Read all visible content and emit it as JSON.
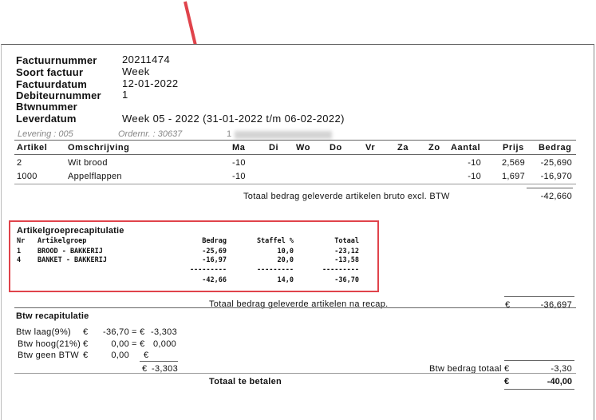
{
  "header": {
    "fields": [
      {
        "label": "Factuurnummer",
        "value": "20211474"
      },
      {
        "label": "Soort factuur",
        "value": "Week"
      },
      {
        "label": "Factuurdatum",
        "value": "12-01-2022"
      },
      {
        "label": "Debiteurnummer",
        "value": "1"
      },
      {
        "label": "Btwnummer",
        "value": ""
      },
      {
        "label": "Leverdatum",
        "value": "Week 05 - 2022 (31-01-2022 t/m 06-02-2022)"
      }
    ]
  },
  "delivery": {
    "levering": "Levering : 005",
    "ordernr": "Ordernr. : 30637",
    "code": "1"
  },
  "items_table": {
    "columns": [
      "Artikel",
      "Omschrijving",
      "Ma",
      "Di",
      "Wo",
      "Do",
      "Vr",
      "Za",
      "Zo",
      "Aantal",
      "Prijs",
      "Bedrag"
    ],
    "rows": [
      {
        "artikel": "2",
        "omschrijving": "Wit brood",
        "ma": "-10",
        "aantal": "-10",
        "prijs": "2,569",
        "bedrag": "-25,690"
      },
      {
        "artikel": "1000",
        "omschrijving": "Appelflappen",
        "ma": "-10",
        "aantal": "-10",
        "prijs": "1,697",
        "bedrag": "-16,970"
      }
    ],
    "total_label": "Totaal bedrag geleverde artikelen bruto excl. BTW",
    "total_value": "-42,660"
  },
  "recap": {
    "title": "Artikelgroeprecapitulatie",
    "columns": {
      "nr": "Nr",
      "group": "Artikelgroep",
      "bedrag": "Bedrag",
      "staffel": "Staffel %",
      "totaal": "Totaal"
    },
    "rows": [
      {
        "nr": "1",
        "group": "BROOD - BAKKERIJ",
        "bedrag": "-25,69",
        "staffel": "10,0",
        "totaal": "-23,12"
      },
      {
        "nr": "4",
        "group": "BANKET - BAKKERIJ",
        "bedrag": "-16,97",
        "staffel": "20,0",
        "totaal": "-13,58"
      }
    ],
    "dashes": "---------",
    "sum": {
      "bedrag": "-42,66",
      "staffel": "14,0",
      "totaal": "-36,70"
    }
  },
  "after_recap": {
    "label": "Totaal bedrag geleverde artikelen na recap.",
    "currency": "€",
    "value": "-36,697"
  },
  "btw": {
    "title": "Btw recapitulatie",
    "lines": [
      {
        "label": "Btw laag(9%)",
        "currency": "€",
        "base": "-36,70",
        "eq": "= €",
        "amount": "-3,303"
      },
      {
        "label": "Btw hoog(21%)",
        "currency": "€",
        "base": "0,00",
        "eq": "= €",
        "amount": "0,000"
      },
      {
        "label": "Btw geen BTW",
        "currency": "€",
        "base": "0,00",
        "eq": "€",
        "amount": ""
      }
    ],
    "subtotal_currency": "€",
    "subtotal": "-3,303",
    "total_label": "Btw bedrag totaal",
    "total_currency": "€",
    "total_value": "-3,30"
  },
  "grand_total": {
    "label": "Totaal te betalen",
    "currency": "€",
    "value": "-40,00"
  },
  "annotation": {
    "arrow_color": "#e0434b",
    "box_color": "#e0434b"
  }
}
